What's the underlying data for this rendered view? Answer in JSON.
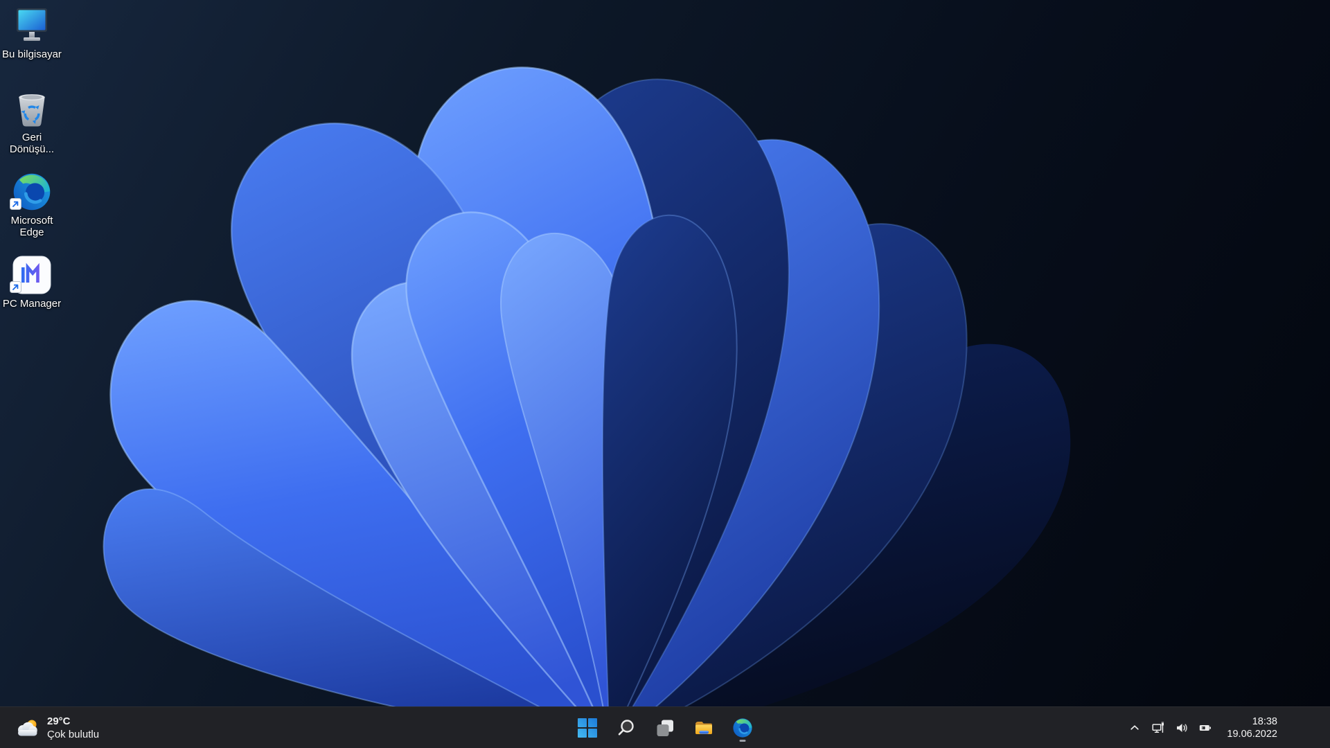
{
  "desktop": {
    "icons": [
      {
        "name": "this-pc",
        "line1": "Bu bilgisayar",
        "line2": ""
      },
      {
        "name": "recycle-bin",
        "line1": "Geri",
        "line2": "Dönüşü..."
      },
      {
        "name": "microsoft-edge",
        "line1": "Microsoft",
        "line2": "Edge"
      },
      {
        "name": "pc-manager",
        "line1": "PC Manager",
        "line2": ""
      }
    ]
  },
  "taskbar": {
    "widget": {
      "icon": "partly-cloudy-icon",
      "temperature": "29°C",
      "condition": "Çok bulutlu"
    },
    "center_buttons": [
      "start",
      "search",
      "task-view",
      "file-explorer",
      "edge"
    ],
    "edge_running": true,
    "tray": {
      "icons": [
        "chevron-up",
        "network-wired",
        "volume",
        "battery-charging"
      ],
      "clock": {
        "time": "18:38",
        "date": "19.06.2022"
      }
    }
  },
  "colors": {
    "taskbar_bg": "#212226",
    "accent_blue": "#2f7cf6",
    "wallpaper_bright": "#4f86f5",
    "wallpaper_dark": "#0a1742",
    "label_text": "#ffffff"
  }
}
